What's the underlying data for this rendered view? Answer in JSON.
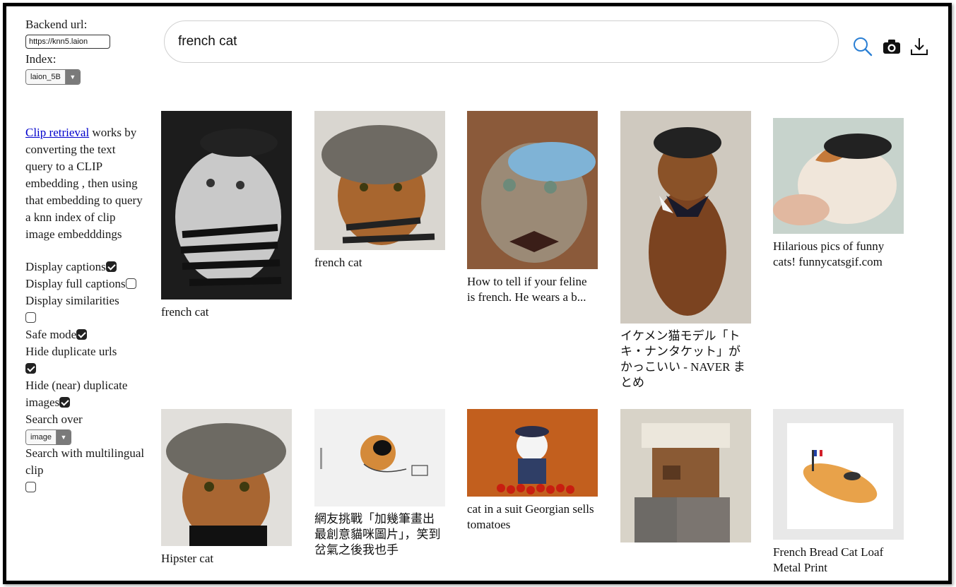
{
  "sidebar": {
    "backend_label": "Backend url:",
    "backend_value": "https://knn5.laion",
    "index_label": "Index:",
    "index_value": "laion_5B",
    "desc_link": "Clip retrieval",
    "desc_text": " works by converting the text query to a CLIP embedding , then using that embedding to query a knn index of clip image embedddings",
    "display_captions": "Display captions",
    "display_full_captions": "Display full captions",
    "display_similarities": "Display similarities",
    "safe_mode": "Safe mode",
    "hide_duplicate_urls": "Hide duplicate urls",
    "hide_near_duplicates": "Hide (near) duplicate images",
    "search_over": "Search over",
    "search_over_value": "image",
    "multilingual": "Search with multilingual clip"
  },
  "search": {
    "query": "french cat"
  },
  "toolbar": {
    "icons": [
      "search-icon",
      "camera-icon",
      "download-icon"
    ]
  },
  "results": [
    {
      "caption": "french cat"
    },
    {
      "caption": "french cat"
    },
    {
      "caption": "How to tell if your feline is french. He wears a b..."
    },
    {
      "caption": "イケメン猫モデル「トキ・ナンタケット」がかっこいい - NAVER まとめ"
    },
    {
      "caption": "Hilarious pics of funny cats! funnycatsgif.com"
    },
    {
      "caption": "Hipster cat"
    },
    {
      "caption": "網友挑戰「加幾筆畫出最創意貓咪圖片」，笑到岔氣之後我也手"
    },
    {
      "caption": "cat in a suit Georgian sells tomatoes"
    },
    {
      "caption": ""
    },
    {
      "caption": "French Bread Cat Loaf Metal Print"
    }
  ]
}
